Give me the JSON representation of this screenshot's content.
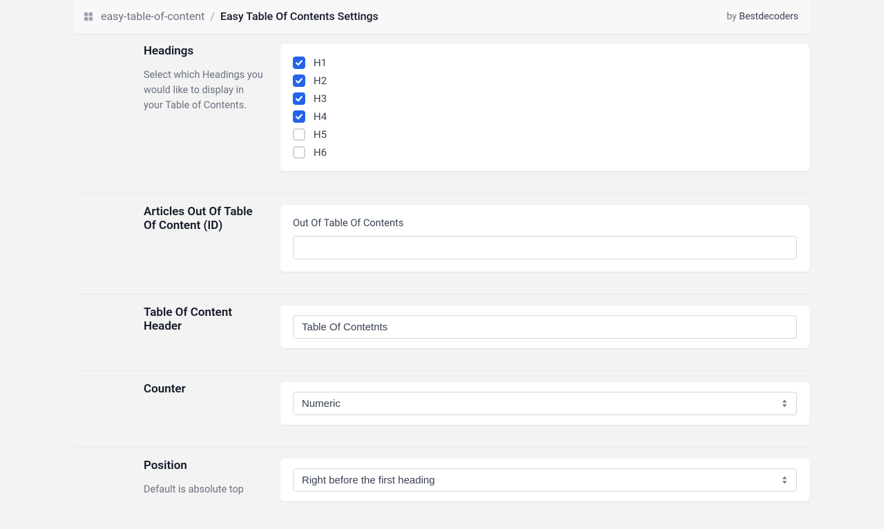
{
  "header": {
    "breadcrumb_parent": "easy-table-of-content",
    "breadcrumb_sep": "/",
    "breadcrumb_current": "Easy Table Of Contents Settings",
    "by_prefix": "by ",
    "author": "Bestdecoders"
  },
  "sections": {
    "headings": {
      "title": "Headings",
      "desc": "Select which Headings you would like to display in your Table of Contents.",
      "options": [
        {
          "label": "H1",
          "checked": true
        },
        {
          "label": "H2",
          "checked": true
        },
        {
          "label": "H3",
          "checked": true
        },
        {
          "label": "H4",
          "checked": true
        },
        {
          "label": "H5",
          "checked": false
        },
        {
          "label": "H6",
          "checked": false
        }
      ]
    },
    "articles_out": {
      "title": "Articles Out Of Table Of Content (ID)",
      "field_label": "Out Of Table Of Contents",
      "value": ""
    },
    "toc_header": {
      "title": "Table Of Content Header",
      "value": "Table Of Contetnts"
    },
    "counter": {
      "title": "Counter",
      "selected": "Numeric"
    },
    "position": {
      "title": "Position",
      "desc": "Default is absolute top",
      "selected": "Right before the first heading"
    }
  }
}
